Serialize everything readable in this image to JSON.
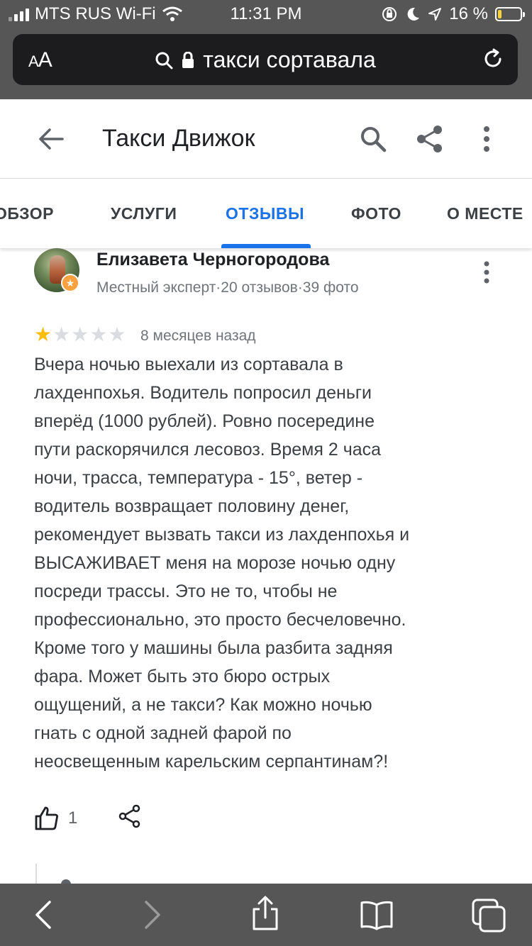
{
  "status_bar": {
    "carrier": "MTS RUS Wi-Fi",
    "time": "11:31 PM",
    "battery_percent": "16 %",
    "battery_level": 0.16,
    "icons": [
      "signal-icon",
      "wifi-icon",
      "orientation-lock-icon",
      "moon-icon",
      "location-icon",
      "battery-icon"
    ]
  },
  "browser": {
    "aa_large": "A",
    "aa_small": "A",
    "url_text": "такси сортавала",
    "icons": [
      "search-icon",
      "lock-icon",
      "reload-icon"
    ]
  },
  "header": {
    "title": "Такси Движок",
    "icons": [
      "back-arrow-icon",
      "search-icon",
      "share-icon",
      "more-vert-icon"
    ]
  },
  "tabs": [
    {
      "label": "ОБЗОР",
      "active": false
    },
    {
      "label": "УСЛУГИ",
      "active": false
    },
    {
      "label": "ОТЗЫВЫ",
      "active": true
    },
    {
      "label": "ФОТО",
      "active": false
    },
    {
      "label": "О МЕСТЕ",
      "active": false
    }
  ],
  "review": {
    "author": "Елизавета Черногородова",
    "meta": "Местный эксперт·20 отзывов·39 фото",
    "rating": 1,
    "max_rating": 5,
    "date": "8 месяцев назад",
    "lines": [
      "Вчера ночью выехали из сортавала в",
      "лахденпохья. Водитель попросил деньги",
      "вперёд (1000 рублей). Ровно посередине",
      "пути раскорячился лесовоз. Время 2 часа",
      "ночи, трасса, температура - 15°, ветер -",
      "водитель возвращает половину денег,",
      "рекомендует вызвать такси из лахденпохья и",
      "ВЫСАЖИВАЕТ меня на морозе ночью одну",
      "посреди трассы. Это не то, чтобы не",
      "профессионально, это просто бесчеловечно.",
      "Кроме того у машины была разбита задняя",
      "фара. Может быть это бюро острых",
      "ощущений, а не такси? Как можно ночью",
      "гнать с одной задней фарой по",
      "неосвещенным карельским серпантинам?!"
    ],
    "likes": "1"
  },
  "toolbar": {
    "icons": [
      "back-icon",
      "forward-icon",
      "share-icon",
      "bookmarks-icon",
      "tabs-icon"
    ]
  },
  "colors": {
    "accent": "#1a73e8",
    "star": "#fbbc04",
    "safari_chrome": "#565656",
    "url_bar": "#1c1c1e"
  }
}
